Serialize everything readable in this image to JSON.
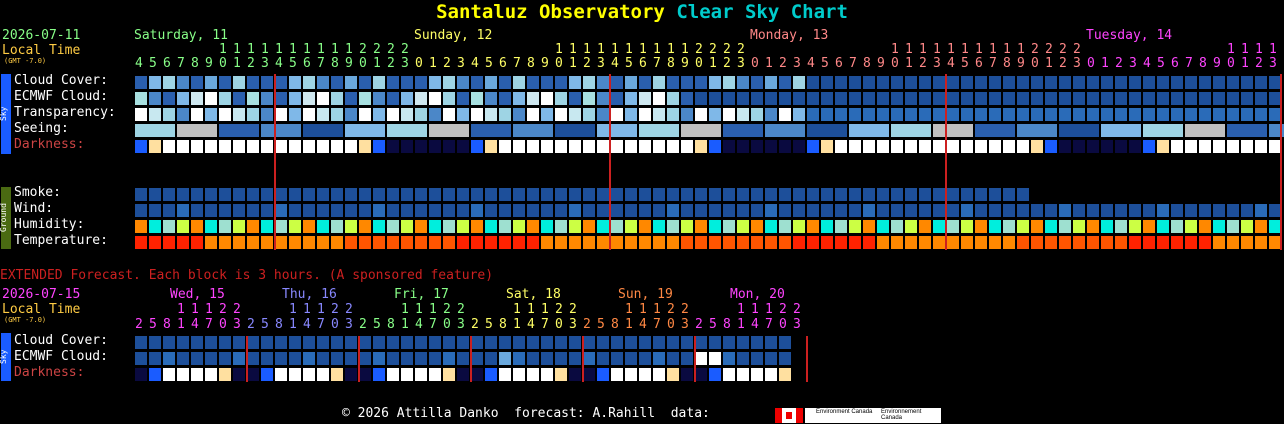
{
  "title": {
    "site": "Santaluz Observatory",
    "chart": "Clear Sky Chart"
  },
  "main": {
    "date": "2026-07-11",
    "local_time": "Local Time",
    "gmt": "(GMT -7.0)",
    "days": [
      "Saturday, 11",
      "Sunday, 12",
      "Monday, 13",
      "Tuesday, 14"
    ],
    "day_colors": [
      "#88ff88",
      "#ffff66",
      "#ff8888",
      "#ff44ff"
    ],
    "tens_rows": [
      "1111111 2222",
      "11111111112222",
      "11111111112222",
      "11111111112222"
    ],
    "units_rows": [
      "45678901230123456789",
      "01234567890123",
      "01234567890123",
      "012345678901230123"
    ],
    "labels": {
      "cloud_cover": "Cloud Cover:",
      "ecmwf_cloud": "ECMWF Cloud:",
      "transparency": "Transparency:",
      "seeing": "Seeing:",
      "darkness": "Darkness:",
      "smoke": "Smoke:",
      "wind": "Wind:",
      "humidity": "Humidity:",
      "temperature": "Temperature:"
    },
    "sky_tag": "Sky",
    "ground_tag": "Ground"
  },
  "extended": {
    "heading": "EXTENDED Forecast. Each block is 3 hours. (A sponsored feature)",
    "date": "2026-07-15",
    "local_time": "Local Time",
    "gmt": "(GMT -7.0)",
    "days": [
      "Wed, 15",
      "Thu, 16",
      "Fri, 17",
      "Sat, 18",
      "Sun, 19",
      "Mon, 20"
    ],
    "day_colors": [
      "#ff44ff",
      "#8888ff",
      "#88ff88",
      "#ffff66",
      "#ff8844",
      "#ff44ff"
    ],
    "tens": "11122",
    "units": "2581470325814703258147032581470325814703258147032581470325814703",
    "labels": {
      "cloud_cover": "Cloud Cover:",
      "ecmwf_cloud": "ECMWF Cloud:",
      "darkness": "Darkness:"
    },
    "sky_tag": "Sky"
  },
  "footer": {
    "text": "© 2026 Attilla Danko  forecast: A.Rahill  data:",
    "logo1": "Environment Canada",
    "logo2": "Environnement Canada"
  },
  "colors": {
    "cloud_clear": "#003fbf",
    "separator": "#cc2020",
    "darkness_label": "#cc4444"
  }
}
